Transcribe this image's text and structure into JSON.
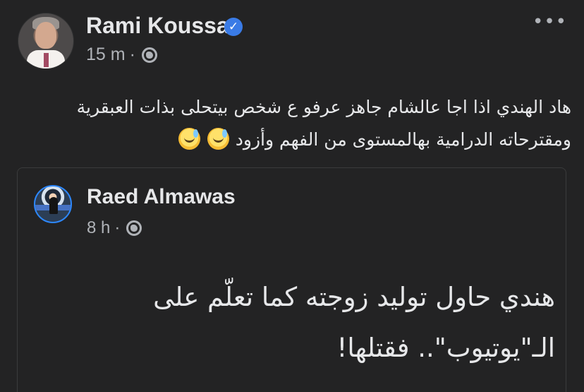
{
  "post": {
    "author_name": "Rami Koussa",
    "time": "15 m",
    "separator": "·",
    "more_icon": "more-horizontal-icon",
    "privacy_icon": "globe-icon",
    "verified_icon": "verified-badge-icon",
    "text_line1": "هاد الهندي اذا اجا عالشام جاهز عرفو ع شخص بيتحلى بذات العبقرية",
    "text_line2": "ومقترحاته الدرامية بهالمستوى من الفهم وأزود",
    "emojis": [
      "😅",
      "😅"
    ]
  },
  "shared_post": {
    "author_name": "Raed Almawas",
    "time": "8 h",
    "separator": "·",
    "privacy_icon": "globe-icon",
    "text_line1": "هندي حاول توليد زوجته كما تعلّم على",
    "text_line2": "الـ\"يوتيوب\".. فقتلها!"
  },
  "colors": {
    "background": "#232324",
    "primary_text": "#e7e8ea",
    "secondary_text": "#b0b3b8",
    "verified_blue": "#3a7be6",
    "shared_avatar_ring": "#2d88ff",
    "card_border": "#3a3b3c"
  }
}
